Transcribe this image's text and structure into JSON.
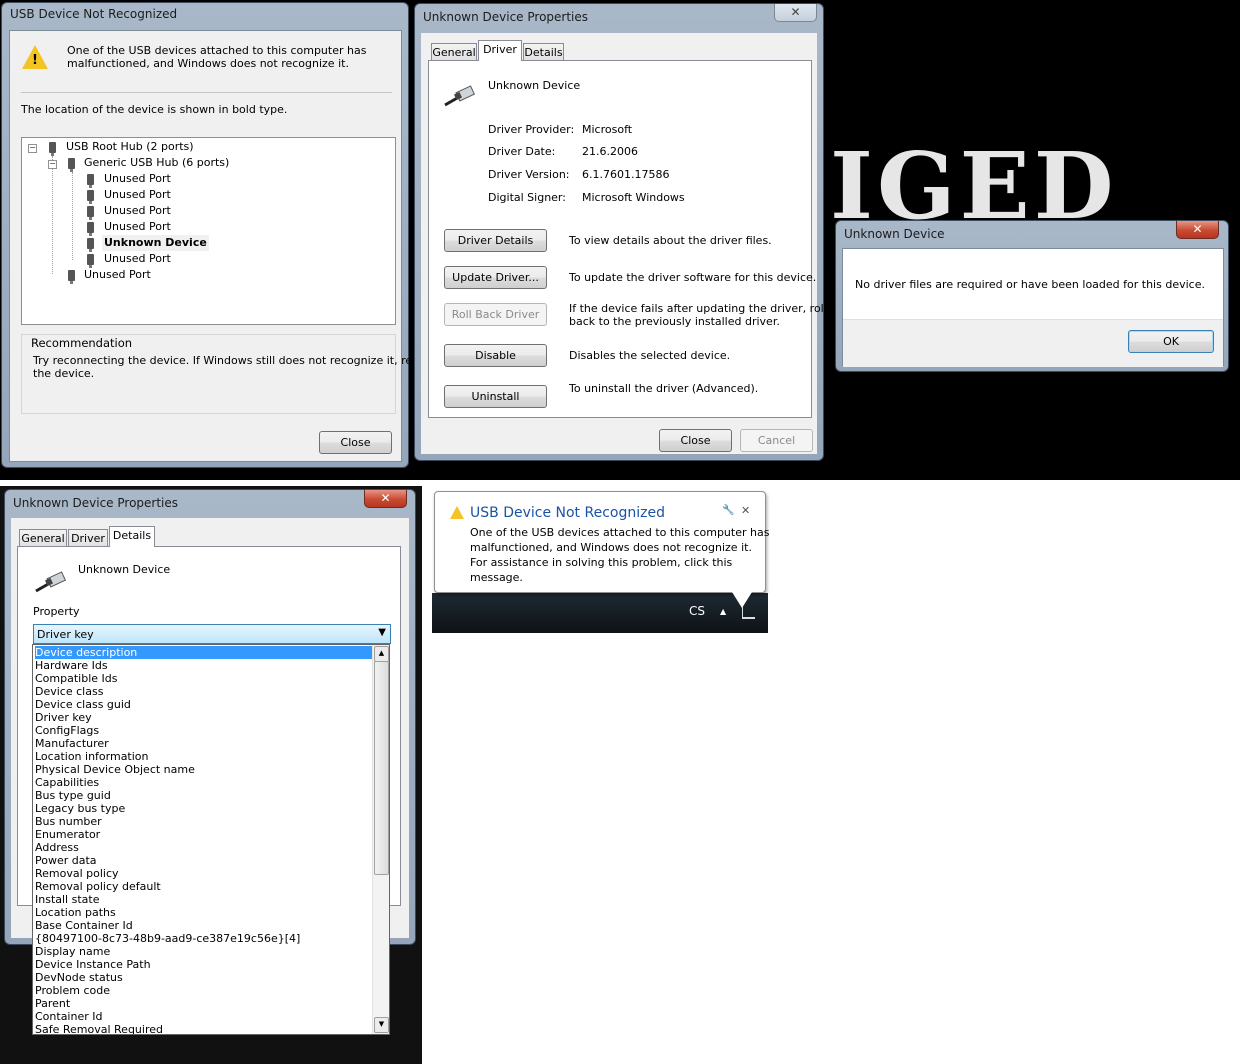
{
  "usb_dialog": {
    "title": "USB Device Not Recognized",
    "message_line1": "One of the USB devices attached to this computer has",
    "message_line2": "malfunctioned, and Windows does not recognize it.",
    "location_hint": "The location of the device is shown in bold type.",
    "tree": [
      {
        "label": "USB Root Hub (2 ports)",
        "bold": false
      },
      {
        "label": "Generic USB Hub (6 ports)",
        "bold": false
      },
      {
        "label": "Unused Port",
        "bold": false
      },
      {
        "label": "Unused Port",
        "bold": false
      },
      {
        "label": "Unused Port",
        "bold": false
      },
      {
        "label": "Unused Port",
        "bold": false
      },
      {
        "label": "Unknown Device",
        "bold": true
      },
      {
        "label": "Unused Port",
        "bold": false
      },
      {
        "label": "Unused Port",
        "bold": false
      }
    ],
    "recommendation_title": "Recommendation",
    "recommendation_line1": "Try reconnecting the device. If Windows still does not recognize it, replace",
    "recommendation_line2": "the device.",
    "close_label": "Close"
  },
  "driver_dialog": {
    "title": "Unknown Device Properties",
    "close_glyph": "✕",
    "tabs": {
      "general": "General",
      "driver": "Driver",
      "details": "Details"
    },
    "device_name": "Unknown Device",
    "fields": [
      {
        "label": "Driver Provider:",
        "value": "Microsoft"
      },
      {
        "label": "Driver Date:",
        "value": "21.6.2006"
      },
      {
        "label": "Driver Version:",
        "value": "6.1.7601.17586"
      },
      {
        "label": "Digital Signer:",
        "value": "Microsoft Windows"
      }
    ],
    "actions": [
      {
        "button": "Driver Details",
        "desc1": "To view details about the driver files.",
        "desc2": "",
        "disabled": false
      },
      {
        "button": "Update Driver...",
        "desc1": "To update the driver software for this device.",
        "desc2": "",
        "disabled": false
      },
      {
        "button": "Roll Back Driver",
        "desc1": "If the device fails after updating the driver, roll",
        "desc2": "back to the previously installed driver.",
        "disabled": true
      },
      {
        "button": "Disable",
        "desc1": "Disables the selected device.",
        "desc2": "",
        "disabled": false
      },
      {
        "button": "Uninstall",
        "desc1": "To uninstall the driver (Advanced).",
        "desc2": "",
        "disabled": false
      }
    ],
    "close_label": "Close",
    "cancel_label": "Cancel"
  },
  "msgbox": {
    "title": "Unknown Device",
    "close_glyph": "✕",
    "message": "No driver files are required or have been loaded for this device.",
    "ok_label": "OK"
  },
  "details_dialog": {
    "title": "Unknown Device Properties",
    "close_glyph": "✕",
    "tabs": {
      "general": "General",
      "driver": "Driver",
      "details": "Details"
    },
    "device_name": "Unknown Device",
    "property_label": "Property",
    "selected_property": "Driver key",
    "properties": [
      "Device description",
      "Hardware Ids",
      "Compatible Ids",
      "Device class",
      "Device class guid",
      "Driver key",
      "ConfigFlags",
      "Manufacturer",
      "Location information",
      "Physical Device Object name",
      "Capabilities",
      "Bus type guid",
      "Legacy bus type",
      "Bus number",
      "Enumerator",
      "Address",
      "Power data",
      "Removal policy",
      "Removal policy default",
      "Install state",
      "Location paths",
      "Base Container Id",
      "{80497100-8c73-48b9-aad9-ce387e19c56e}[4]",
      "Display name",
      "Device Instance Path",
      "DevNode status",
      "Problem code",
      "Parent",
      "Container Id",
      "Safe Removal Required"
    ],
    "highlighted_index": 0
  },
  "balloon": {
    "title": "USB Device Not Recognized",
    "line1": "One of the USB devices attached to this computer has",
    "line2": "malfunctioned, and Windows does not recognize it.",
    "line3": "For assistance in solving this problem, click this",
    "line4": "message.",
    "close_glyph": "✕",
    "tray_lang": "CS",
    "tray_arrow": "▲"
  },
  "background": {
    "art_text": "IGED"
  },
  "colors": {
    "selection": "#3399ff",
    "balloon_title": "#1a53a8",
    "close_red": "#c74b33"
  }
}
